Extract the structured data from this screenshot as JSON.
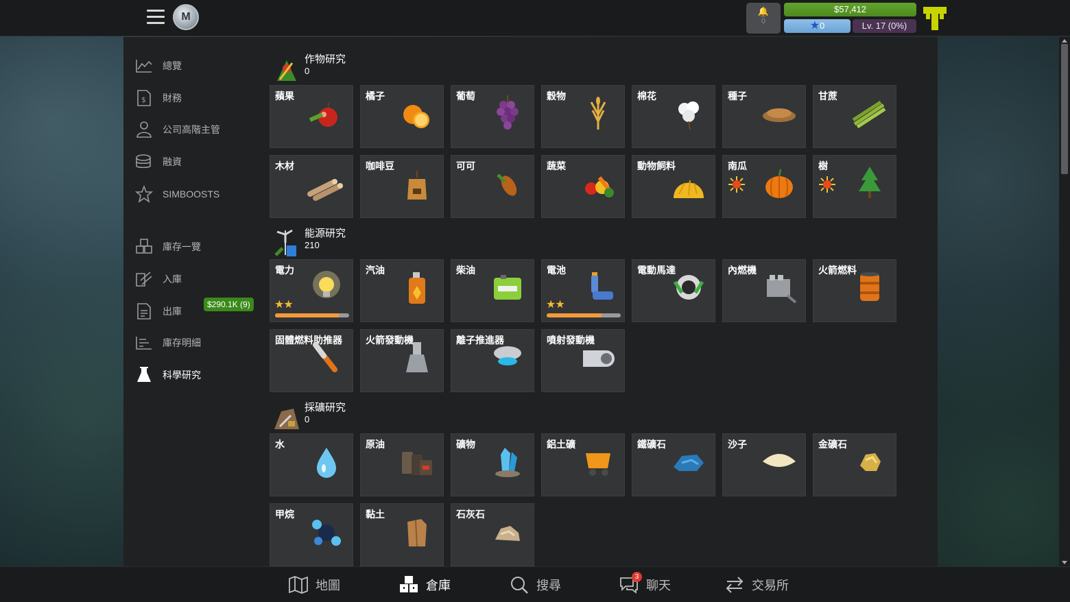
{
  "topbar": {
    "notif_count": "0",
    "money": "$57,412",
    "stars": "0",
    "level": "Lv. 17 (0%)"
  },
  "sidebar": {
    "items": [
      {
        "label": "總覽",
        "icon": "chart-icon"
      },
      {
        "label": "財務",
        "icon": "finance-document-icon"
      },
      {
        "label": "公司高階主管",
        "icon": "executives-icon"
      },
      {
        "label": "融資",
        "icon": "coins-icon"
      },
      {
        "label": "SIMBOOSTS",
        "icon": "star-outline-icon"
      },
      {
        "label": "庫存一覽",
        "icon": "warehouse-boxes-icon"
      },
      {
        "label": "入庫",
        "icon": "incoming-icon"
      },
      {
        "label": "出庫",
        "icon": "outgoing-document-icon"
      },
      {
        "label": "庫存明細",
        "icon": "list-icon"
      },
      {
        "label": "科學研究",
        "icon": "flask-icon"
      }
    ],
    "outgoing_badge": "$290.1K (9)"
  },
  "sections": {
    "crops": {
      "title": "作物研究",
      "count": "0",
      "tiles": [
        "蘋果",
        "橘子",
        "葡萄",
        "穀物",
        "棉花",
        "種子",
        "甘蔗",
        "木材",
        "咖啡豆",
        "可可",
        "蔬菜",
        "動物飼料",
        "南瓜",
        "樹"
      ]
    },
    "energy": {
      "title": "能源研究",
      "count": "210",
      "tiles": [
        "電力",
        "汽油",
        "柴油",
        "電池",
        "電動馬達",
        "內燃機",
        "火箭燃料",
        "固體燃料助推器",
        "火箭發動機",
        "離子推進器",
        "噴射發動機"
      ],
      "stars": "★★",
      "power_progress": 0.86,
      "battery_progress": 0.74
    },
    "mining": {
      "title": "採礦研究",
      "count": "0",
      "tiles": [
        "水",
        "原油",
        "礦物",
        "鋁土礦",
        "鐵礦石",
        "沙子",
        "金礦石",
        "甲烷",
        "黏土",
        "石灰石"
      ]
    }
  },
  "bottomnav": {
    "items": [
      {
        "label": "地圖",
        "icon": "map-icon"
      },
      {
        "label": "倉庫",
        "icon": "warehouse-icon"
      },
      {
        "label": "搜尋",
        "icon": "search-icon"
      },
      {
        "label": "聊天",
        "icon": "chat-icon"
      },
      {
        "label": "交易所",
        "icon": "exchange-icon"
      }
    ],
    "chat_badge": "3"
  },
  "colors": {
    "money_green": "#62a32c",
    "progress_orange": "#f39a3a",
    "star_yellow": "#f7b731",
    "badge_red": "#e03a2e"
  }
}
